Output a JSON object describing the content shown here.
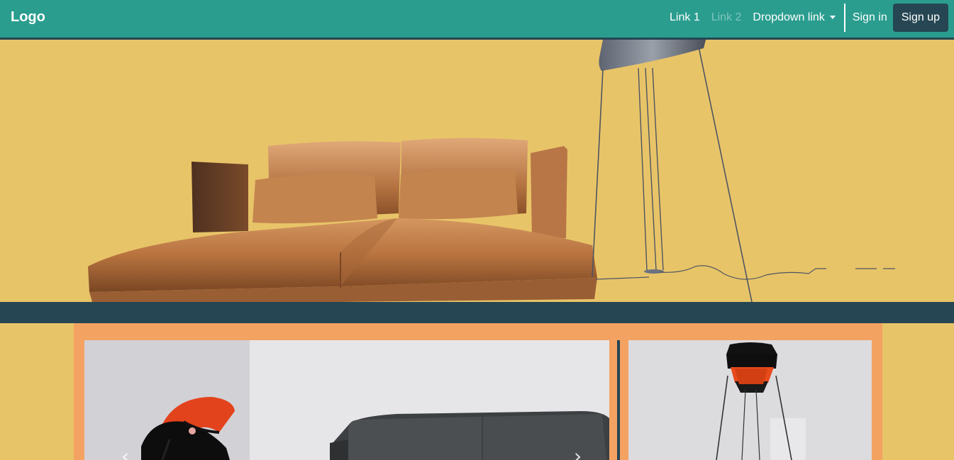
{
  "navbar": {
    "brand": "Logo",
    "links": [
      {
        "label": "Link 1",
        "disabled": false
      },
      {
        "label": "Link 2",
        "disabled": true
      }
    ],
    "dropdown_label": "Dropdown link",
    "signin_label": "Sign in",
    "signup_label": "Sign up"
  },
  "carousel": {
    "prev_icon": "‹",
    "next_icon": "›"
  },
  "colors": {
    "nav_bg": "#2a9d8f",
    "dark": "#264653",
    "page_bg": "#e8c468",
    "panel_bg": "#f4a261"
  }
}
